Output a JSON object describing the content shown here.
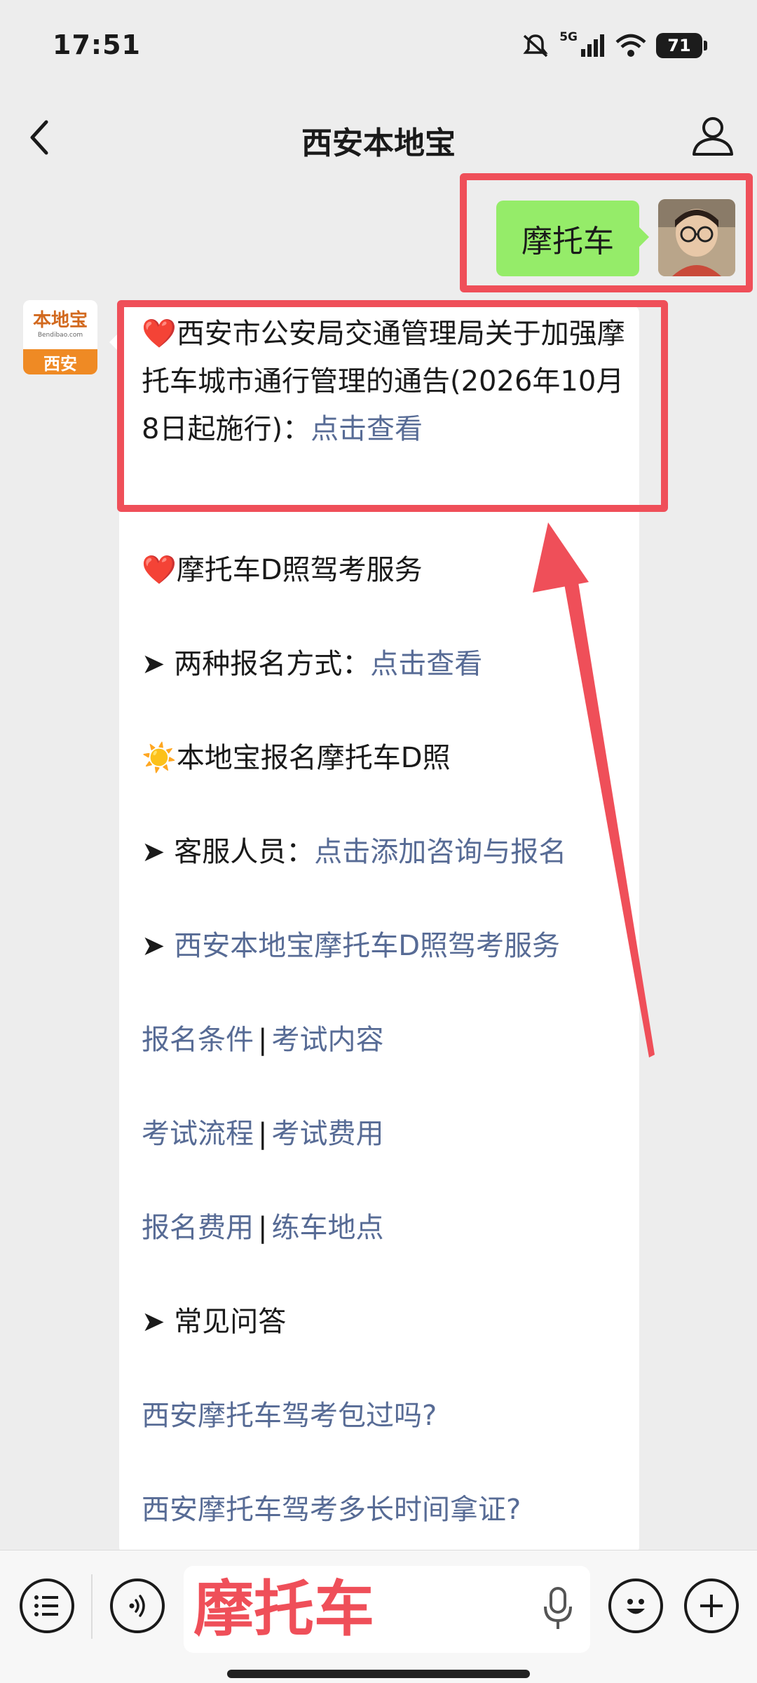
{
  "status_bar": {
    "time": "17:51",
    "network": "5G",
    "battery": "71"
  },
  "nav": {
    "title": "西安本地宝"
  },
  "sent_message": {
    "text": "摩托车"
  },
  "bot_avatar": {
    "brand": "本地宝",
    "domain": "Bendibao.com",
    "city": "西安"
  },
  "reply": {
    "notice": {
      "emoji": "❤️",
      "text": "西安市公安局交通管理局关于加强摩托车城市通行管理的通告(2026年10月8日起施行)：",
      "link": "点击查看"
    },
    "section_heading": {
      "emoji": "❤️",
      "text": "摩托车D照驾考服务"
    },
    "two_ways": {
      "prefix": "➤",
      "label": "两种报名方式：",
      "link": "点击查看"
    },
    "signup": {
      "emoji": "☀️",
      "text": "本地宝报名摩托车D照"
    },
    "service": {
      "prefix": "➤",
      "label": "客服人员：",
      "link": "点击添加咨询与报名"
    },
    "service_link": {
      "prefix": "➤",
      "link": "西安本地宝摩托车D照驾考服务"
    },
    "pairs": [
      {
        "a": "报名条件",
        "sep": "|",
        "b": "考试内容"
      },
      {
        "a": "考试流程",
        "sep": "|",
        "b": "考试费用"
      },
      {
        "a": "报名费用",
        "sep": "|",
        "b": "练车地点"
      }
    ],
    "faq_heading": {
      "prefix": "➤",
      "text": "常见问答"
    },
    "faq": [
      "西安摩托车驾考包过吗?",
      "西安摩托车驾考多长时间拿证?"
    ]
  },
  "input": {
    "value": "摩托车"
  },
  "colors": {
    "highlight": "#ef4f59",
    "link": "#576b95",
    "sent_bubble": "#95ec69"
  }
}
